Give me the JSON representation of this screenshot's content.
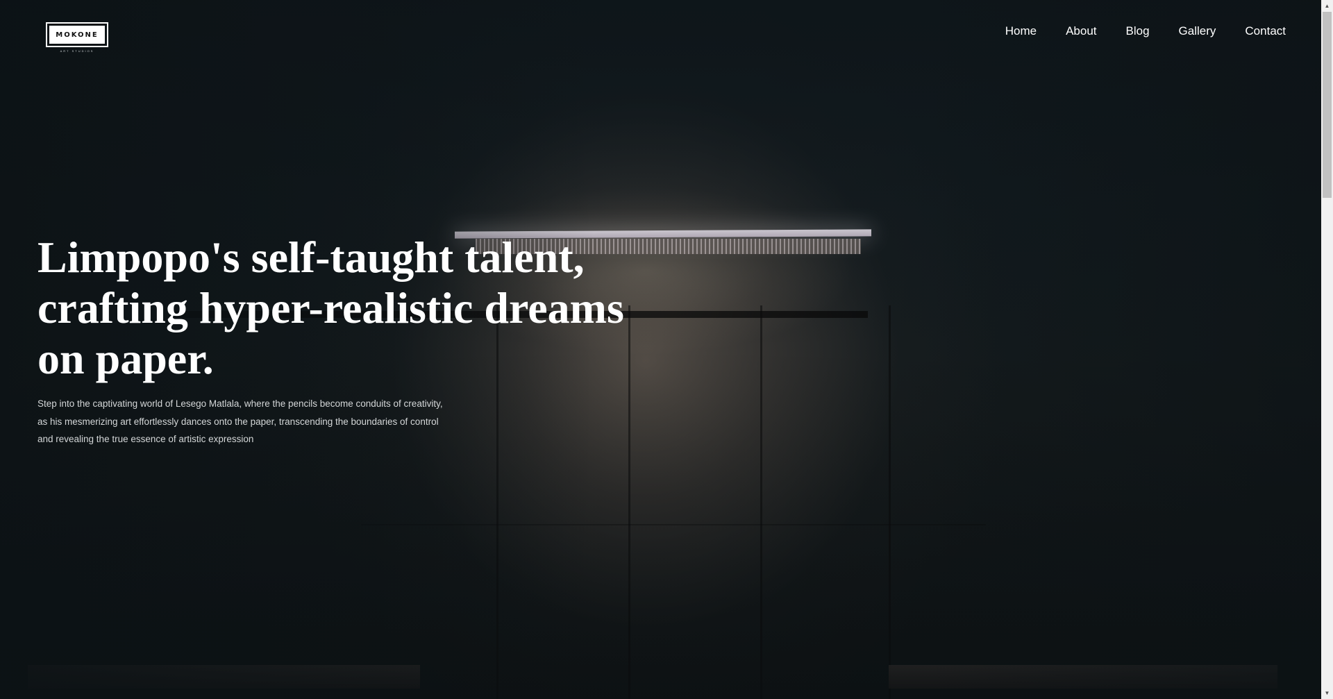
{
  "logo": {
    "name": "MOKONE",
    "tagline": "ART STUDIOS"
  },
  "nav": {
    "items": [
      {
        "label": "Home"
      },
      {
        "label": "About"
      },
      {
        "label": "Blog"
      },
      {
        "label": "Gallery"
      },
      {
        "label": "Contact"
      }
    ]
  },
  "hero": {
    "title": "Limpopo's self-taught talent, crafting hyper-realistic dreams on paper.",
    "description": "Step into the captivating world of Lesego Matlala, where the pencils become conduits of creativity, as his mesmerizing art effortlessly dances onto the paper, transcending the boundaries of control and revealing the true essence of artistic expression"
  },
  "colors": {
    "background": "#111a1e",
    "text": "#ffffff",
    "muted_text": "#d4d7d8"
  },
  "icons": {
    "scroll_up": "scroll-up-arrow-icon",
    "scroll_down": "scroll-down-arrow-icon"
  }
}
